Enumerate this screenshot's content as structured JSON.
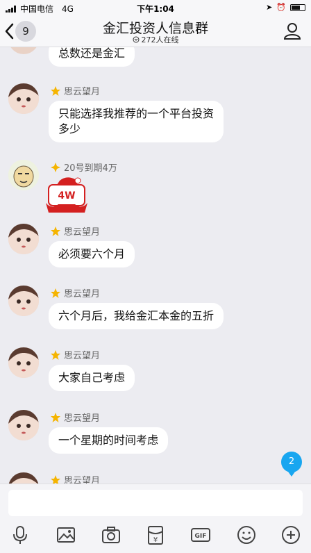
{
  "status_bar": {
    "carrier": "中国电信",
    "network": "4G",
    "time": "下午1:04"
  },
  "header": {
    "back_count": "9",
    "title": "金汇投资人信息群",
    "online": "272人在线"
  },
  "messages": [
    {
      "sender": "",
      "text": "总数还是金汇",
      "avatar": "avatar-partial"
    },
    {
      "sender": "思云望月",
      "text_lines": [
        "只能选择我推荐的一个平台投资",
        "多少"
      ],
      "avatar": "avatar-girl"
    },
    {
      "sender": "20号到期4万",
      "sticker": "4W",
      "avatar": "avatar-cartoon"
    },
    {
      "sender": "思云望月",
      "text": "必须要六个月",
      "avatar": "avatar-girl"
    },
    {
      "sender": "思云望月",
      "text": "六个月后，我给金汇本金的五折",
      "avatar": "avatar-girl"
    },
    {
      "sender": "思云望月",
      "text": "大家自己考虑",
      "avatar": "avatar-girl"
    },
    {
      "sender": "思云望月",
      "text": "一个星期的时间考虑",
      "avatar": "avatar-girl"
    },
    {
      "sender": "思云望月",
      "text": "",
      "avatar": "avatar-girl"
    }
  ],
  "unread_count": "2",
  "input": {
    "placeholder": ""
  },
  "toolbar": [
    "mic-icon",
    "image-icon",
    "camera-icon",
    "red-packet-icon",
    "gif-icon",
    "emoji-icon",
    "plus-icon"
  ],
  "colors": {
    "accent": "#18a6f0",
    "bubble": "#ffffff",
    "background": "#ececf1",
    "rank_star": "#f5b400"
  }
}
